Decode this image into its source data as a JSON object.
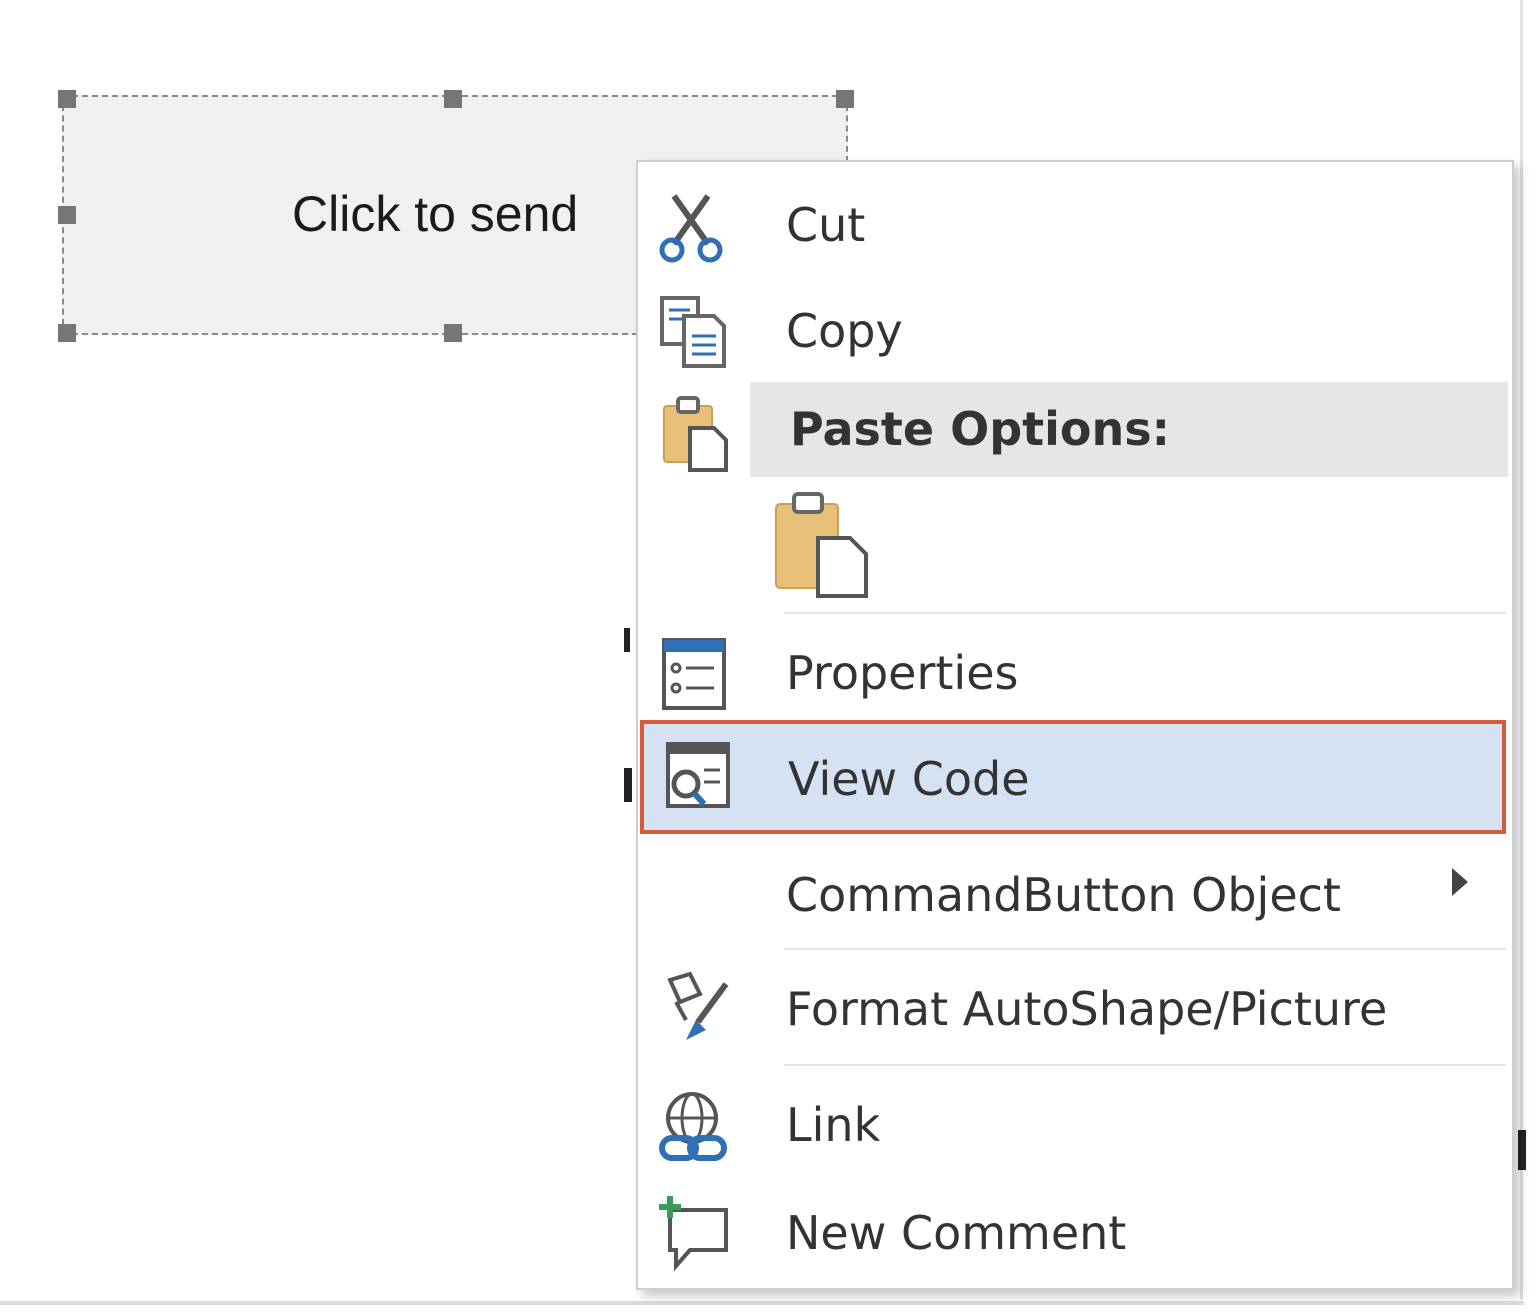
{
  "control": {
    "caption": "Click to send"
  },
  "context_menu": {
    "items": [
      {
        "id": "cut",
        "label": "Cut",
        "icon": "scissors-icon"
      },
      {
        "id": "copy",
        "label": "Copy",
        "icon": "copy-icon"
      },
      {
        "id": "paste_options",
        "label": "Paste Options:",
        "icon": "clipboard-icon"
      },
      {
        "id": "properties",
        "label": "Properties",
        "icon": "properties-icon"
      },
      {
        "id": "view_code",
        "label": "View Code",
        "icon": "view-code-icon"
      },
      {
        "id": "commandbutton_object",
        "label": "CommandButton Object",
        "icon": "submenu-arrow-icon"
      },
      {
        "id": "format_autoshape",
        "label": "Format AutoShape/Picture",
        "icon": "format-painter-icon"
      },
      {
        "id": "link",
        "label": "Link",
        "icon": "link-globe-icon"
      },
      {
        "id": "new_comment",
        "label": "New Comment",
        "icon": "new-comment-icon"
      }
    ],
    "paste_option_icon": "paste-keep-source-icon",
    "highlighted_item": "View Code",
    "colors": {
      "highlight_fill": "#d5e2f3",
      "highlight_border": "#d75a3a",
      "icon_blue": "#2f6fb5",
      "clipboard_tan": "#e8c07a"
    }
  }
}
